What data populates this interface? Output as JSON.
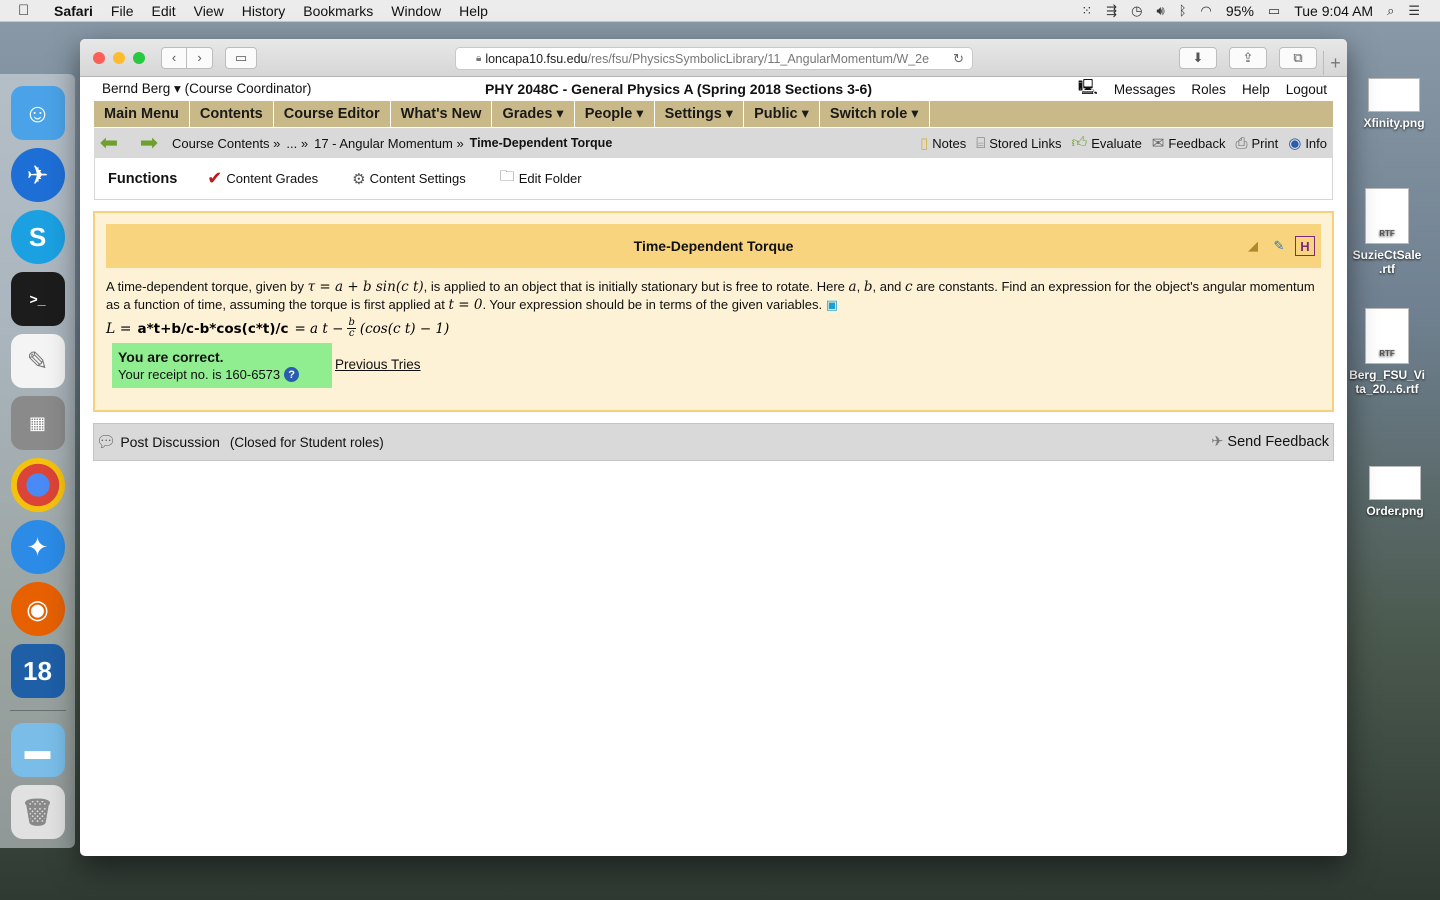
{
  "menubar": {
    "app": "Safari",
    "items": [
      "File",
      "Edit",
      "View",
      "History",
      "Bookmarks",
      "Window",
      "Help"
    ],
    "battery": "95%",
    "clock": "Tue 9:04 AM"
  },
  "desktop": {
    "files": [
      {
        "name": "Xfinity.png"
      },
      {
        "name": "SuzieCtSale\n.rtf",
        "badge": "RTF"
      },
      {
        "name": "Berg_FSU_Vi\nta_20...6.rtf",
        "badge": "RTF"
      },
      {
        "name": "Order.png"
      }
    ]
  },
  "browser": {
    "url_host": "loncapa10.fsu.edu",
    "url_path": "/res/fsu/PhysicsSymbolicLibrary/11_AngularMomentum/W_2e"
  },
  "lc": {
    "user": "Bernd Berg",
    "role": "(Course Coordinator)",
    "course": "PHY 2048C - General Physics A (Spring 2018 Sections 3-6)",
    "top_links": [
      "Messages",
      "Roles",
      "Help",
      "Logout"
    ],
    "menu": [
      "Main Menu",
      "Contents",
      "Course Editor",
      "What's New",
      "Grades ▾",
      "People ▾",
      "Settings ▾",
      "Public ▾",
      "Switch role ▾"
    ],
    "breadcrumbs": [
      "Course Contents »",
      "... »",
      "17 - Angular Momentum »"
    ],
    "breadcrumb_current": "Time-Dependent Torque",
    "nav_actions": [
      "Notes",
      "Stored Links",
      "Evaluate",
      "Feedback",
      "Print",
      "Info"
    ],
    "functions_title": "Functions",
    "functions": [
      "Content Grades",
      "Content Settings",
      "Edit Folder"
    ]
  },
  "problem": {
    "title": "Time-Dependent Torque",
    "text_1": "A time-dependent torque, given by ",
    "tau_expr": "τ = a + b sin(c t)",
    "text_2": ", is applied to an object that is initially stationary but is free to rotate. Here ",
    "var_a": "a",
    "sep_1": ", ",
    "var_b": "b",
    "sep_2": ", and ",
    "var_c": "c",
    "text_3": " are constants. Find an expression for the object's angular momentum as a function of time, assuming the torque is first applied at ",
    "t_zero": "t = 0",
    "text_4": ". Your expression should be in terms of the given variables.",
    "answer_lhs": "L =",
    "answer_input": "a*t+b/c-b*cos(c*t)/c",
    "answer_eq": "= a t −",
    "frac_num": "b",
    "frac_den": "c",
    "answer_tail": "(cos(c t) − 1)",
    "correct": "You are correct.",
    "receipt": "Your receipt no. is 160-6573",
    "previous_tries": "Previous Tries"
  },
  "discussion": {
    "post": "Post Discussion",
    "closed": "(Closed for Student roles)",
    "send_feedback": "Send Feedback"
  },
  "colors": {
    "menu_bg": "#c9b989",
    "problem_bg": "#fdf1d6",
    "problem_head": "#f9d47f",
    "correct_bg": "#90ee90"
  }
}
